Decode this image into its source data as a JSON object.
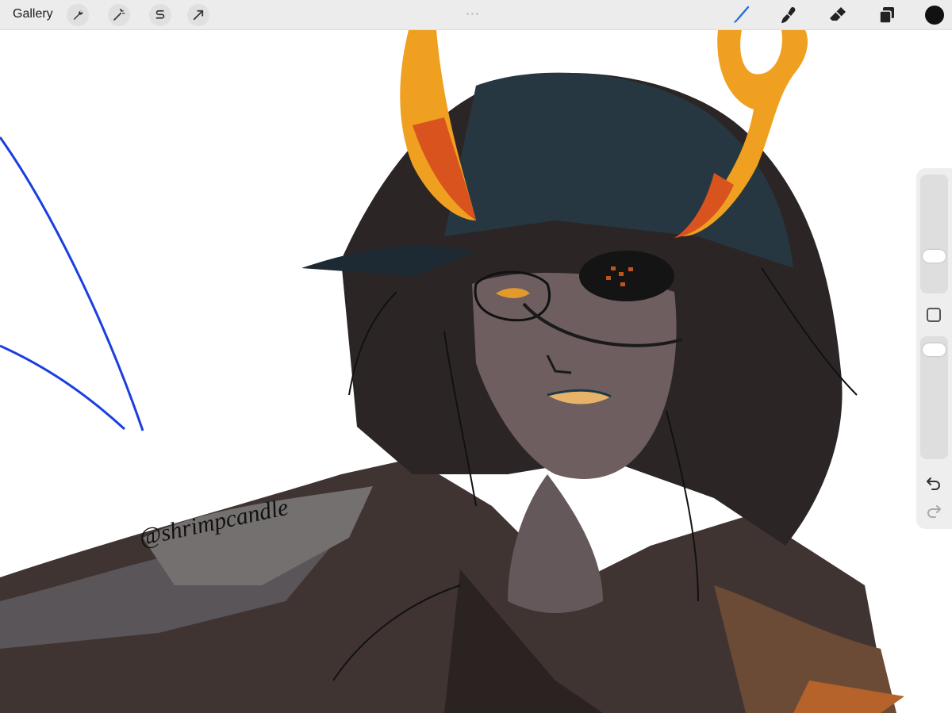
{
  "toolbar": {
    "gallery_label": "Gallery",
    "left_tools": [
      {
        "name": "actions",
        "icon": "wrench-icon"
      },
      {
        "name": "adjustments",
        "icon": "magic-wand-icon"
      },
      {
        "name": "selection",
        "icon": "selection-s-icon"
      },
      {
        "name": "transform",
        "icon": "arrow-cursor-icon"
      }
    ],
    "right_tools": [
      {
        "name": "brush",
        "icon": "brush-icon",
        "active": true
      },
      {
        "name": "smudge",
        "icon": "smudge-finger-icon"
      },
      {
        "name": "eraser",
        "icon": "eraser-icon"
      },
      {
        "name": "layers",
        "icon": "layers-icon"
      }
    ],
    "current_color": "#111111",
    "active_tool_color": "#1f6fdc"
  },
  "sidebar": {
    "brush_size_level": 0.7,
    "opacity_level": 0.15,
    "buttons": [
      "modify-square-icon",
      "undo-icon",
      "redo-icon"
    ]
  },
  "canvas": {
    "signature": "@shrimpcandle",
    "stroke_color": "#1a3ee0",
    "horn_color": "#f0a020"
  }
}
